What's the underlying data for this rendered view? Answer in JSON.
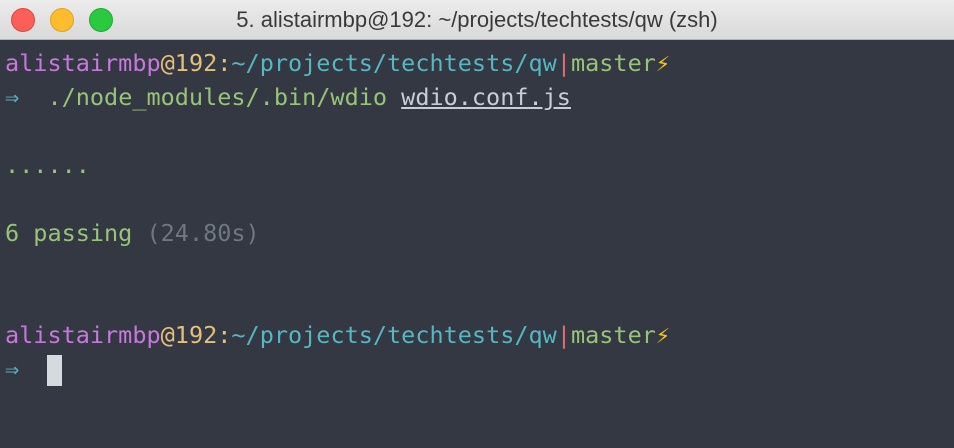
{
  "window": {
    "title": "5. alistairmbp@192: ~/projects/techtests/qw (zsh)"
  },
  "prompt1": {
    "user": "alistairmbp",
    "at": "@",
    "host": "192",
    "colon": ":",
    "path": "~/projects/techtests/qw",
    "separator": "|",
    "branch": "master",
    "bolt": "⚡"
  },
  "command": {
    "arrow": "⇒",
    "program": "./node_modules/.bin/wdio",
    "argument": "wdio.conf.js"
  },
  "output": {
    "dots": "......",
    "passing": "6 passing",
    "duration": "(24.80s)"
  },
  "prompt2": {
    "user": "alistairmbp",
    "at": "@",
    "host": "192",
    "colon": ":",
    "path": "~/projects/techtests/qw",
    "separator": "|",
    "branch": "master",
    "bolt": "⚡",
    "arrow": "⇒"
  },
  "colors": {
    "background": "#333842",
    "user": "#c678dd",
    "host": "#e5c07b",
    "path": "#56b6c2",
    "branch": "#98c379",
    "separator": "#e06c75"
  }
}
